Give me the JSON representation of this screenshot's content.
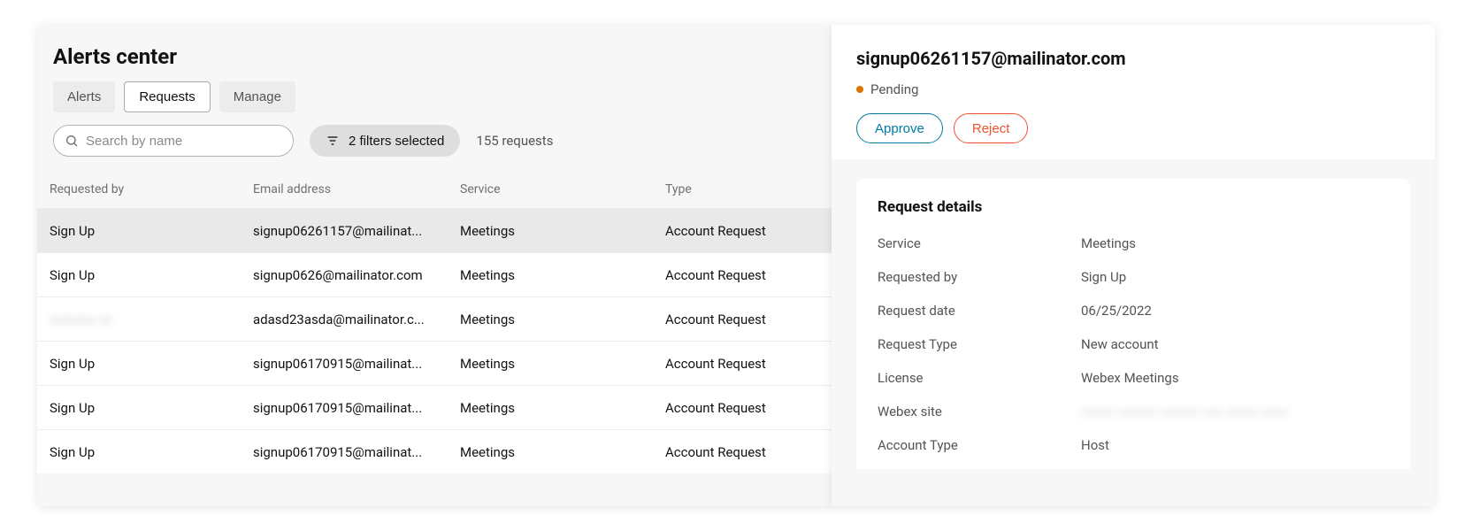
{
  "page_title": "Alerts center",
  "tabs": {
    "alerts": "Alerts",
    "requests": "Requests",
    "manage": "Manage"
  },
  "search": {
    "placeholder": "Search by name"
  },
  "filters_label": "2 filters selected",
  "requests_count_label": "155 requests",
  "columns": {
    "requested_by": "Requested by",
    "email": "Email address",
    "service": "Service",
    "type": "Type"
  },
  "rows": [
    {
      "requested_by": "Sign Up",
      "email": "signup06261157@mailinat...",
      "service": "Meetings",
      "type": "Account Request",
      "selected": true
    },
    {
      "requested_by": "Sign Up",
      "email": "signup0626@mailinator.com",
      "service": "Meetings",
      "type": "Account Request"
    },
    {
      "requested_by": "",
      "requested_by_blurred": true,
      "email": "adasd23asda@mailinator.c...",
      "service": "Meetings",
      "type": "Account Request"
    },
    {
      "requested_by": "Sign Up",
      "email": "signup06170915@mailinat...",
      "service": "Meetings",
      "type": "Account Request"
    },
    {
      "requested_by": "Sign Up",
      "email": "signup06170915@mailinat...",
      "service": "Meetings",
      "type": "Account Request"
    },
    {
      "requested_by": "Sign Up",
      "email": "signup06170915@mailinat...",
      "service": "Meetings",
      "type": "Account Request"
    }
  ],
  "detail": {
    "title": "signup06261157@mailinator.com",
    "status": "Pending",
    "approve_label": "Approve",
    "reject_label": "Reject",
    "section_title": "Request details",
    "fields": {
      "service_k": "Service",
      "service_v": "Meetings",
      "requested_by_k": "Requested by",
      "requested_by_v": "Sign Up",
      "request_date_k": "Request date",
      "request_date_v": "06/25/2022",
      "request_type_k": "Request Type",
      "request_type_v": "New account",
      "license_k": "License",
      "license_v": "Webex Meetings",
      "webex_site_k": "Webex site",
      "webex_site_v": "",
      "account_type_k": "Account Type",
      "account_type_v": "Host"
    }
  }
}
